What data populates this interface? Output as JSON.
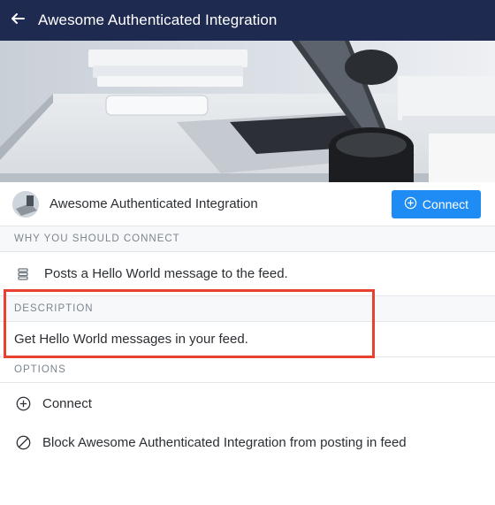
{
  "topbar": {
    "title": "Awesome Authenticated Integration"
  },
  "app": {
    "name": "Awesome Authenticated Integration",
    "connect_label": "Connect",
    "accent": "#1f8cf5"
  },
  "why": {
    "header": "WHY YOU SHOULD CONNECT",
    "items": [
      {
        "icon": "stack-icon",
        "text": "Posts a Hello World message to the feed."
      }
    ]
  },
  "description": {
    "header": "DESCRIPTION",
    "text": "Get Hello World messages in your feed."
  },
  "options": {
    "header": "OPTIONS",
    "items": [
      {
        "icon": "plus-circle-icon",
        "label": "Connect"
      },
      {
        "icon": "block-icon",
        "label": "Block Awesome Authenticated Integration from posting in feed"
      }
    ]
  },
  "colors": {
    "topbar": "#1f2a50",
    "highlight": "#e8412f"
  }
}
